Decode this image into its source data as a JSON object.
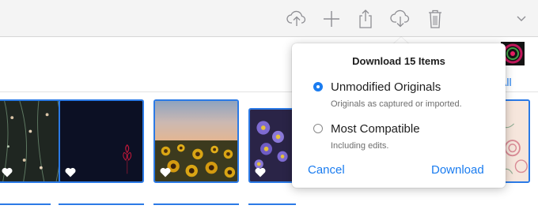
{
  "toolbar": {
    "icons": [
      "upload-icon",
      "add-icon",
      "share-icon",
      "download-icon",
      "trash-icon",
      "chevron-down-icon"
    ]
  },
  "header": {
    "select_all_label": "t All"
  },
  "popover": {
    "title": "Download 15 Items",
    "options": [
      {
        "label": "Unmodified Originals",
        "description": "Originals as captured or imported.",
        "selected": true
      },
      {
        "label": "Most Compatible",
        "description": "Including edits.",
        "selected": false
      }
    ],
    "cancel_label": "Cancel",
    "download_label": "Download"
  },
  "colors": {
    "accent": "#1a7cf0",
    "selection_border": "#2b7ae6"
  },
  "photos": [
    {
      "subject": "floral-pattern-dark",
      "favorite": true
    },
    {
      "subject": "dark-navy-rose",
      "favorite": true
    },
    {
      "subject": "sunflower-field",
      "favorite": true
    },
    {
      "subject": "purple-asters",
      "favorite": true
    },
    {
      "subject": "pink-roses",
      "favorite": false
    }
  ]
}
